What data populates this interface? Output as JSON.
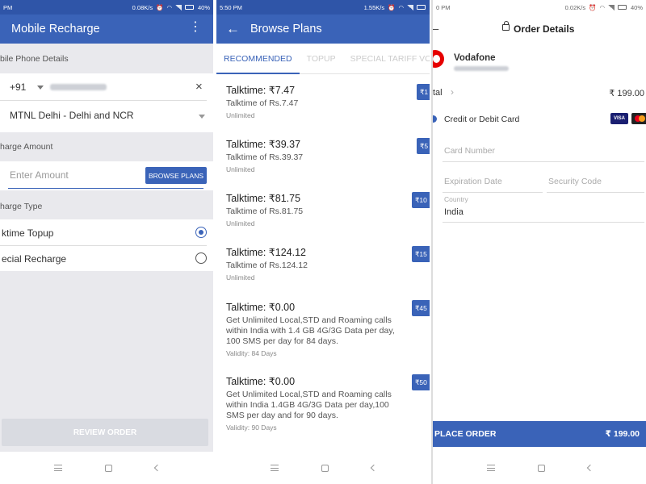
{
  "panel1": {
    "status": {
      "time": "PM",
      "speed": "0.08K/s",
      "battery": "40%"
    },
    "app_title": "Mobile Recharge",
    "mobile_section_label": "bile Phone Details",
    "country_code": "+91",
    "operator": "MTNL Delhi - Delhi and NCR",
    "amount_section_label": "harge Amount",
    "amount_placeholder": "Enter Amount",
    "browse_plans_label": "BROWSE PLANS",
    "type_section_label": "harge Type",
    "options": [
      {
        "label": "ktime Topup",
        "selected": true
      },
      {
        "label": "ecial Recharge",
        "selected": false
      }
    ],
    "review_label": "REVIEW ORDER"
  },
  "panel2": {
    "status": {
      "time": "5:50 PM",
      "speed": "1.55K/s"
    },
    "title": "Browse Plans",
    "tabs": [
      "RECOMMENDED",
      "TOPUP",
      "SPECIAL TARIFF VOU"
    ],
    "plans": [
      {
        "talktime": "Talktime: ₹7.47",
        "desc": "Talktime of Rs.7.47",
        "validity": "Unlimited",
        "price": "₹1"
      },
      {
        "talktime": "Talktime: ₹39.37",
        "desc": "Talktime of Rs.39.37",
        "validity": "Unlimited",
        "price": "₹5"
      },
      {
        "talktime": "Talktime: ₹81.75",
        "desc": "Talktime of Rs.81.75",
        "validity": "Unlimited",
        "price": "₹10"
      },
      {
        "talktime": "Talktime: ₹124.12",
        "desc": "Talktime of Rs.124.12",
        "validity": "Unlimited",
        "price": "₹15"
      },
      {
        "talktime": "Talktime: ₹0.00",
        "desc": "Get Unlimited Local,STD and Roaming calls within India with 1.4 GB 4G/3G Data per day, 100 SMS per day for 84 days.",
        "validity": "Validity: 84 Days",
        "price": "₹45"
      },
      {
        "talktime": "Talktime: ₹0.00",
        "desc": "Get Unlimited Local,STD and Roaming calls within India 1.4GB 4G/3G Data per day,100 SMS per day and for 90 days.",
        "validity": "Validity: 90 Days",
        "price": "₹50"
      }
    ]
  },
  "panel3": {
    "status": {
      "time": "0 PM",
      "speed": "0.02K/s",
      "battery": "40%"
    },
    "title": "Order Details",
    "operator": "Vodafone",
    "total_label": "tal",
    "total_amount": "₹ 199.00",
    "payment_method": "Credit or Debit Card",
    "card_badges": [
      "VISA",
      "MC"
    ],
    "card_number_placeholder": "Card Number",
    "expiry_placeholder": "Expiration Date",
    "cvv_placeholder": "Security Code",
    "country_label": "Country",
    "country_value": "India",
    "place_order_label": "PLACE ORDER",
    "place_order_amount": "₹ 199.00"
  }
}
